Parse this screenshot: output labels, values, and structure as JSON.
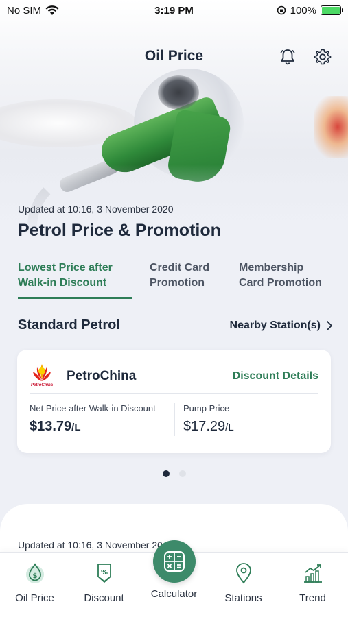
{
  "status_bar": {
    "carrier": "No SIM",
    "time": "3:19 PM",
    "battery": "100%"
  },
  "header": {
    "title": "Oil Price",
    "bell_icon": "bell-icon",
    "gear_icon": "gear-icon"
  },
  "hero": {
    "updated": "Updated at 10:16, 3 November 2020",
    "title": "Petrol Price & Promotion"
  },
  "tabs": [
    {
      "label_line1": "Lowest Price after",
      "label_line2": "Walk-in Discount",
      "active": true
    },
    {
      "label_line1": "Credit Card",
      "label_line2": "Promotion",
      "active": false
    },
    {
      "label_line1": "Membership",
      "label_line2": "Card Promotion",
      "active": false
    }
  ],
  "section": {
    "title": "Standard Petrol",
    "nearby_link": "Nearby Station(s)"
  },
  "card": {
    "brand": "PetroChina",
    "logo_text": "PetroChina",
    "discount_link": "Discount Details",
    "net_label": "Net Price after Walk-in Discount",
    "net_price": "$13.79",
    "net_unit": "/L",
    "pump_label": "Pump Price",
    "pump_price": "$17.29",
    "pump_unit": "/L"
  },
  "pager": {
    "total": 2,
    "active": 1
  },
  "second_sheet": {
    "updated": "Updated at 10:16, 3 November 20"
  },
  "bottom_nav": {
    "items": [
      {
        "label": "Oil Price",
        "icon": "oil-drop-icon"
      },
      {
        "label": "Discount",
        "icon": "discount-tag-icon"
      },
      {
        "label": "Calculator",
        "icon": "calculator-icon"
      },
      {
        "label": "Stations",
        "icon": "location-pin-icon"
      },
      {
        "label": "Trend",
        "icon": "trend-chart-icon"
      }
    ]
  },
  "colors": {
    "accent_green": "#2e7d57",
    "calculator_green": "#3d8a6a",
    "text_dark": "#1f2a3c",
    "background": "#eef0f6"
  }
}
